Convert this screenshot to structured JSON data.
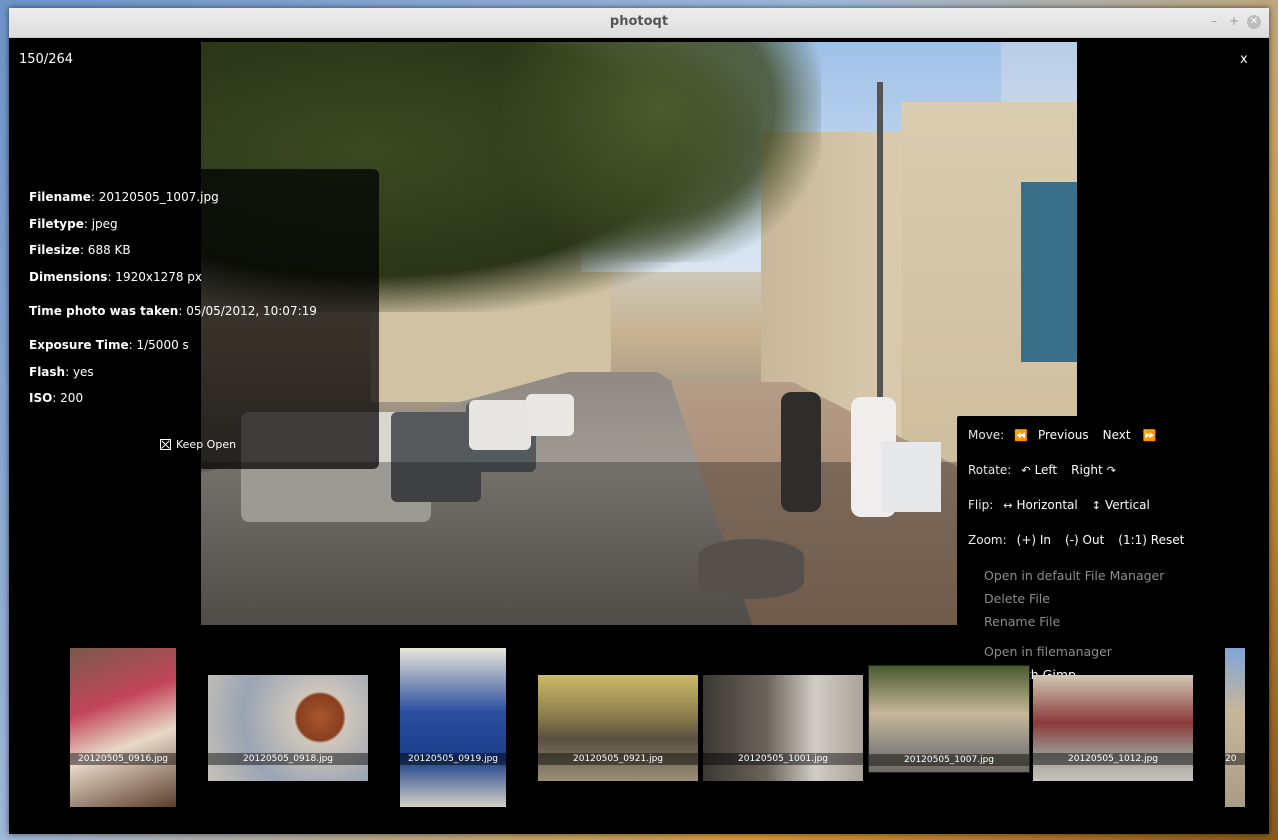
{
  "window": {
    "title": "photoqt"
  },
  "viewer": {
    "counter": "150/264",
    "close_label": "x"
  },
  "info": {
    "filename_label": "Filename",
    "filename_value": ": 20120505_1007.jpg",
    "filetype_label": "Filetype",
    "filetype_value": ": jpeg",
    "filesize_label": "Filesize",
    "filesize_value": ": 688 KB",
    "dimensions_label": "Dimensions",
    "dimensions_value": ": 1920x1278 px",
    "time_label": "Time photo was taken",
    "time_value": ": 05/05/2012, 10:07:19",
    "exposure_label": "Exposure Time",
    "exposure_value": ": 1/5000 s",
    "flash_label": "Flash",
    "flash_value": ": yes",
    "iso_label": "ISO",
    "iso_value": ": 200",
    "keep_open": "Keep Open"
  },
  "menu": {
    "move_label": "Move:",
    "previous": "Previous",
    "next": "Next",
    "rotate_label": "Rotate:",
    "left": "Left",
    "right": "Right",
    "flip_label": "Flip:",
    "horizontal": "Horizontal",
    "vertical": "Vertical",
    "zoom_label": "Zoom:",
    "zoom_in": "(+) In",
    "zoom_out": "(-) Out",
    "zoom_reset": "(1:1) Reset",
    "open_default_fm": "Open in default File Manager",
    "delete_file": "Delete File",
    "rename_file": "Rename File",
    "open_filemanager": "Open in filemanager",
    "edit_gimp": "Edit with Gimp"
  },
  "thumbnails": [
    {
      "name": "20120505_0916.jpg"
    },
    {
      "name": "20120505_0918.jpg"
    },
    {
      "name": "20120505_0919.jpg"
    },
    {
      "name": "20120505_0921.jpg"
    },
    {
      "name": "20120505_1001.jpg"
    },
    {
      "name": "20120505_1007.jpg"
    },
    {
      "name": "20120505_1012.jpg"
    },
    {
      "name": "20"
    }
  ]
}
